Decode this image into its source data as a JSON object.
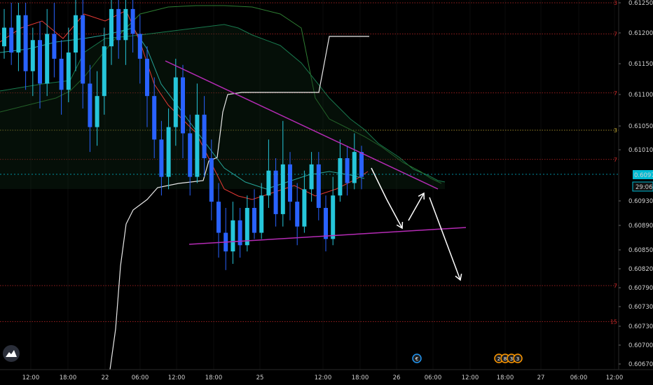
{
  "chart_data": {
    "type": "candlestick",
    "price_axis": {
      "ticks": [
        "0.61250",
        "0.61200",
        "0.61150",
        "0.61100",
        "0.61050",
        "0.61010",
        "0.60972",
        "0.60930",
        "0.60890",
        "0.60850",
        "0.60820",
        "0.60790",
        "0.60730",
        "0.60730",
        "0.60700",
        "0.60670"
      ],
      "tick_values": [
        0.6125,
        0.612,
        0.6115,
        0.611,
        0.6105,
        0.6101,
        0.60972,
        0.6093,
        0.6089,
        0.6085,
        0.6082,
        0.6079,
        0.6076,
        0.6073,
        0.607,
        0.6067
      ],
      "range": [
        0.6067,
        0.6125
      ]
    },
    "time_axis": {
      "ticks": [
        "12:00",
        "18:00",
        "22",
        "06:00",
        "12:00",
        "18:00",
        "25",
        "12:00",
        "18:00",
        "26",
        "06:00",
        "12:00",
        "18:00",
        "27",
        "06:00",
        "12:00"
      ],
      "tick_hours": [
        12,
        18,
        24,
        30,
        36,
        42,
        48,
        60,
        66,
        72,
        78,
        84,
        90,
        96,
        102,
        108
      ]
    },
    "current_price": {
      "value": "0.60972",
      "countdown": "29:06",
      "color": "#00bcd4"
    },
    "levels": [
      {
        "price": 0.6125,
        "tag": "3",
        "color": "#c62828"
      },
      {
        "price": 0.612,
        "tag": "7",
        "color": "#c62828"
      },
      {
        "price": 0.61105,
        "tag": "7",
        "color": "#c62828"
      },
      {
        "price": 0.61045,
        "tag": "3",
        "color": "#c9b037"
      },
      {
        "price": 0.60998,
        "tag": "7",
        "color": "#c62828"
      },
      {
        "price": 0.60795,
        "tag": "7",
        "color": "#c62828"
      },
      {
        "price": 0.60737,
        "tag": "15",
        "color": "#c62828"
      }
    ],
    "candles": [
      [
        0,
        0.6118,
        0.6121,
        0.6124,
        0.6116
      ],
      [
        1,
        0.6121,
        0.6117,
        0.6125,
        0.6115
      ],
      [
        2,
        0.6117,
        0.6123,
        0.6125,
        0.6114
      ],
      [
        3,
        0.6123,
        0.6114,
        0.6125,
        0.6111
      ],
      [
        4,
        0.6114,
        0.6119,
        0.6121,
        0.611
      ],
      [
        5,
        0.6119,
        0.6112,
        0.6122,
        0.6108
      ],
      [
        6,
        0.6112,
        0.612,
        0.6124,
        0.611
      ],
      [
        7,
        0.612,
        0.6116,
        0.6125,
        0.6113
      ],
      [
        8,
        0.6116,
        0.6111,
        0.6119,
        0.6107
      ],
      [
        9,
        0.6111,
        0.6117,
        0.6121,
        0.6109
      ],
      [
        10,
        0.6117,
        0.6123,
        0.6126,
        0.6114
      ],
      [
        11,
        0.6123,
        0.6112,
        0.6126,
        0.6108
      ],
      [
        12,
        0.6112,
        0.6105,
        0.6115,
        0.6101
      ],
      [
        13,
        0.6105,
        0.611,
        0.6114,
        0.6102
      ],
      [
        14,
        0.611,
        0.6118,
        0.6121,
        0.6107
      ],
      [
        15,
        0.6118,
        0.6124,
        0.6126,
        0.6115
      ],
      [
        16,
        0.6124,
        0.6119,
        0.6126,
        0.6116
      ],
      [
        17,
        0.6119,
        0.6124,
        0.6126,
        0.6115
      ],
      [
        18,
        0.6124,
        0.612,
        0.6126,
        0.6117
      ],
      [
        19,
        0.612,
        0.6116,
        0.6123,
        0.6112
      ],
      [
        20,
        0.6116,
        0.611,
        0.6118,
        0.6105
      ],
      [
        21,
        0.611,
        0.6103,
        0.6113,
        0.61
      ],
      [
        22,
        0.6103,
        0.6097,
        0.6106,
        0.6094
      ],
      [
        23,
        0.6097,
        0.6105,
        0.6108,
        0.6095
      ],
      [
        24,
        0.6105,
        0.6113,
        0.6116,
        0.6102
      ],
      [
        25,
        0.6113,
        0.6104,
        0.6115,
        0.61
      ],
      [
        26,
        0.6104,
        0.6097,
        0.6107,
        0.6094
      ],
      [
        27,
        0.6097,
        0.6107,
        0.6112,
        0.6096
      ],
      [
        28,
        0.6107,
        0.61,
        0.611,
        0.6097
      ],
      [
        29,
        0.61,
        0.6093,
        0.6103,
        0.609
      ],
      [
        30,
        0.6093,
        0.6088,
        0.6096,
        0.6084
      ],
      [
        31,
        0.6088,
        0.6085,
        0.6092,
        0.6082
      ],
      [
        32,
        0.6085,
        0.609,
        0.6093,
        0.6083
      ],
      [
        33,
        0.609,
        0.6086,
        0.6092,
        0.6084
      ],
      [
        34,
        0.6086,
        0.6092,
        0.6094,
        0.6085
      ],
      [
        35,
        0.6092,
        0.6088,
        0.6095,
        0.6087
      ],
      [
        36,
        0.6088,
        0.6094,
        0.6096,
        0.6087
      ],
      [
        37,
        0.6094,
        0.6098,
        0.6103,
        0.6092
      ],
      [
        38,
        0.6098,
        0.6091,
        0.61,
        0.6089
      ],
      [
        39,
        0.6091,
        0.6099,
        0.6106,
        0.6089
      ],
      [
        40,
        0.6099,
        0.6093,
        0.6101,
        0.609
      ],
      [
        41,
        0.6093,
        0.6089,
        0.6096,
        0.6086
      ],
      [
        42,
        0.6089,
        0.6095,
        0.6098,
        0.6088
      ],
      [
        43,
        0.6095,
        0.6099,
        0.6101,
        0.6093
      ],
      [
        44,
        0.6099,
        0.6092,
        0.6101,
        0.609
      ],
      [
        45,
        0.6092,
        0.6087,
        0.6094,
        0.6085
      ],
      [
        46,
        0.6087,
        0.6094,
        0.6097,
        0.6086
      ],
      [
        47,
        0.6094,
        0.61,
        0.6103,
        0.6093
      ],
      [
        48,
        0.61,
        0.6096,
        0.6102,
        0.6094
      ],
      [
        49,
        0.6096,
        0.6101,
        0.6104,
        0.6095
      ],
      [
        50,
        0.6101,
        0.6097,
        0.6102,
        0.6095
      ]
    ],
    "trendlines": [
      {
        "name": "",
        "color": "#b52bb5",
        "from": [
          236,
          87
        ],
        "to": [
          625,
          270
        ]
      },
      {
        "name": "",
        "color": "#b52bb5",
        "from": [
          270,
          349
        ],
        "to": [
          665,
          325
        ]
      }
    ]
  },
  "price_labels": {
    "current": "0.60972",
    "countdown": "29:06"
  },
  "brand": {
    "icon": "tradingview-logo-icon"
  },
  "event_markers": [
    {
      "label": "€",
      "color": "#2196f3"
    },
    {
      "label": "2",
      "color": "#ff9800"
    },
    {
      "label": "8",
      "color": "#ff9800"
    },
    {
      "label": "3",
      "color": "#ff9800"
    },
    {
      "label": "3",
      "color": "#ff9800"
    }
  ]
}
